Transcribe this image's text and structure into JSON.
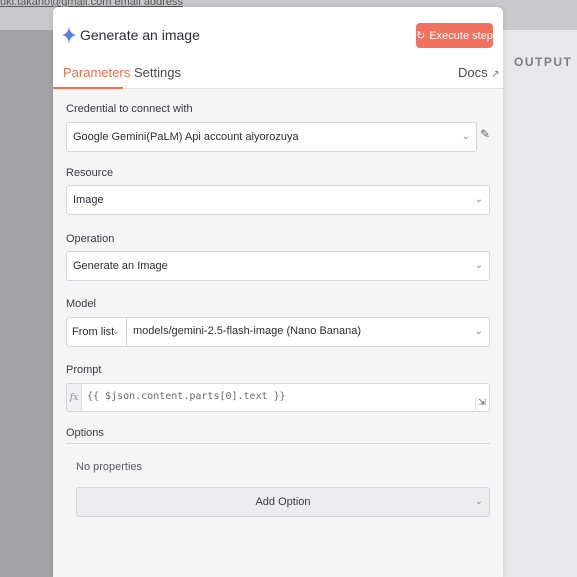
{
  "background": {
    "email_fragment": "uki.takano@gmail.com email address",
    "output_label": "OUTPUT"
  },
  "header": {
    "title": "Generate an image",
    "execute_label": "Execute step",
    "execute_color": "#f0715e",
    "icon": "gemini-star-icon"
  },
  "tabs": {
    "parameters": "Parameters",
    "settings": "Settings",
    "docs": "Docs",
    "active": "Parameters",
    "accent": "#ef6c4f"
  },
  "credential": {
    "label": "Credential to connect with",
    "value": "Google Gemini(PaLM) Api account aiyorozuya"
  },
  "resource": {
    "label": "Resource",
    "value": "Image"
  },
  "operation": {
    "label": "Operation",
    "value": "Generate an Image"
  },
  "model": {
    "label": "Model",
    "mode": "From list",
    "value": "models/gemini-2.5-flash-image (Nano Banana)"
  },
  "prompt": {
    "label": "Prompt",
    "fx": "fx",
    "expression": "{{ $json.content.parts[0].text }}"
  },
  "options": {
    "title": "Options",
    "empty_text": "No properties",
    "add_label": "Add Option"
  }
}
